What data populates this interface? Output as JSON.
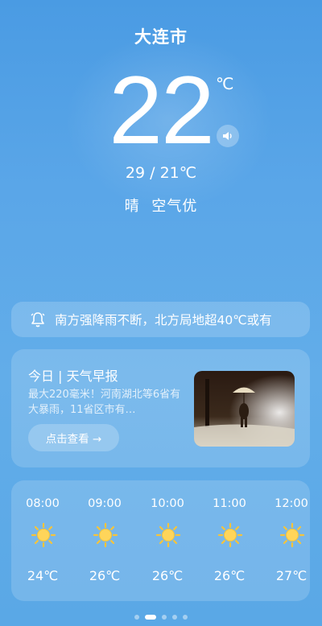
{
  "location": {
    "city": "大连市"
  },
  "current": {
    "temperature": "22",
    "unit": "℃",
    "range": "29 / 21℃",
    "condition": "晴",
    "air_quality": "空气优"
  },
  "alert": {
    "text": "南方强降雨不断，北方局地超40℃或有"
  },
  "brief": {
    "title": "今日 | 天气早报",
    "description": "最大220毫米！河南湖北等6省有大暴雨，11省区市有…",
    "button_label": "点击查看 →"
  },
  "hourly": [
    {
      "time": "08:00",
      "icon": "sun-icon",
      "temp": "24℃"
    },
    {
      "time": "09:00",
      "icon": "sun-icon",
      "temp": "26℃"
    },
    {
      "time": "10:00",
      "icon": "sun-icon",
      "temp": "26℃"
    },
    {
      "time": "11:00",
      "icon": "sun-icon",
      "temp": "26℃"
    },
    {
      "time": "12:00",
      "icon": "sun-icon",
      "temp": "27℃"
    }
  ],
  "pager": {
    "count": 5,
    "active_index": 1
  },
  "colors": {
    "sun": "#f6c43a",
    "sun_core": "#ffd55a"
  }
}
